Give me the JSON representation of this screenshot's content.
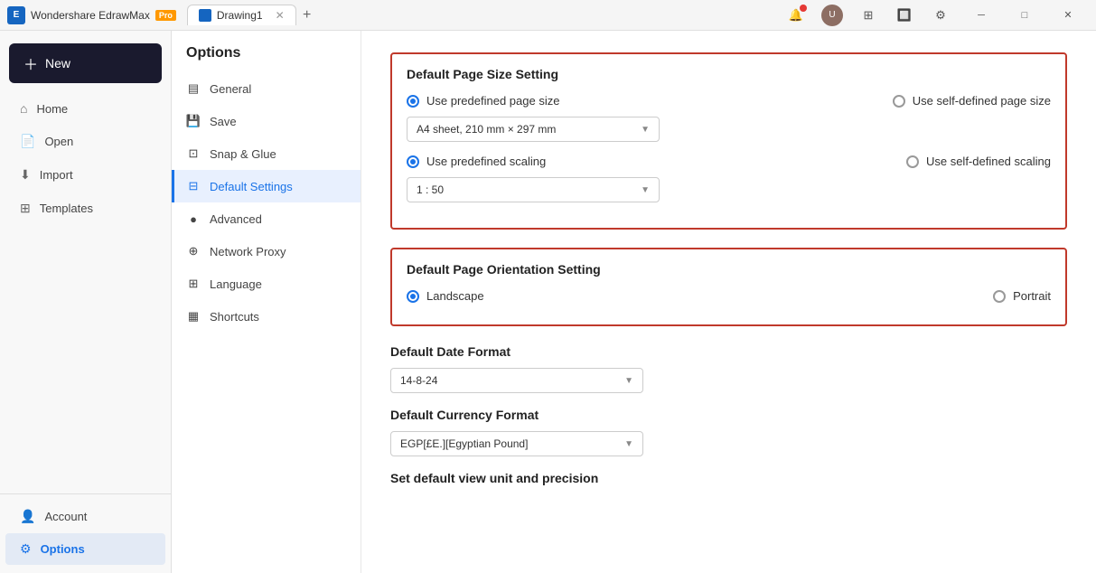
{
  "app": {
    "name": "Wondershare EdrawMax",
    "badge": "Pro",
    "tab_label": "Drawing1",
    "tab_add": "+"
  },
  "titlebar": {
    "bell_icon": "🔔",
    "user_icon": "👤",
    "grid_icon": "⊞",
    "share_icon": "⇧",
    "settings_icon": "⚙",
    "minimize": "─",
    "maximize": "□",
    "close": "✕"
  },
  "sidebar": {
    "new_label": "New",
    "items": [
      {
        "id": "home",
        "label": "Home"
      },
      {
        "id": "open",
        "label": "Open"
      },
      {
        "id": "import",
        "label": "Import"
      },
      {
        "id": "templates",
        "label": "Templates"
      }
    ],
    "bottom_items": [
      {
        "id": "account",
        "label": "Account"
      },
      {
        "id": "options",
        "label": "Options"
      }
    ]
  },
  "options_panel": {
    "title": "Options",
    "items": [
      {
        "id": "general",
        "label": "General"
      },
      {
        "id": "save",
        "label": "Save"
      },
      {
        "id": "snap-glue",
        "label": "Snap & Glue"
      },
      {
        "id": "default-settings",
        "label": "Default Settings",
        "active": true
      },
      {
        "id": "advanced",
        "label": "Advanced"
      },
      {
        "id": "network-proxy",
        "label": "Network Proxy"
      },
      {
        "id": "language",
        "label": "Language"
      },
      {
        "id": "shortcuts",
        "label": "Shortcuts"
      }
    ]
  },
  "content": {
    "section1_title": "Default Page Size Setting",
    "radio1_predefined": "Use predefined page size",
    "radio1_selfdefined": "Use self-defined page size",
    "select_pagesize": "A4 sheet, 210 mm × 297 mm",
    "radio2_predefined_scaling": "Use predefined scaling",
    "radio2_selfdefined_scaling": "Use self-defined scaling",
    "select_scaling": "1 : 50",
    "section2_title": "Default Page Orientation Setting",
    "radio_landscape": "Landscape",
    "radio_portrait": "Portrait",
    "date_format_label": "Default Date Format",
    "select_date": "14-8-24",
    "currency_label": "Default Currency Format",
    "select_currency": "EGP[£E.][Egyptian Pound]",
    "unit_label": "Set default view unit and precision"
  }
}
